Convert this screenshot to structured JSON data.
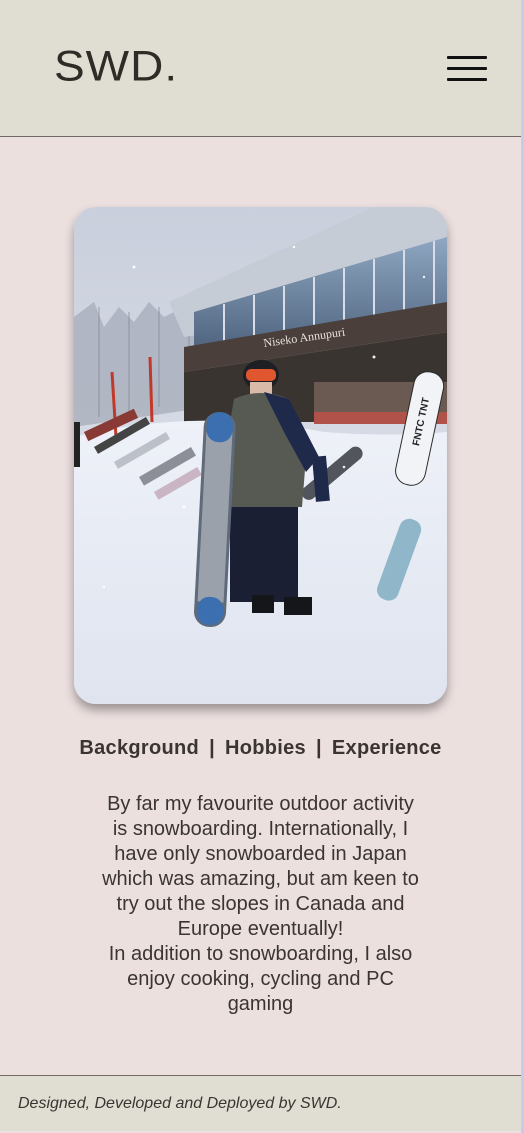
{
  "header": {
    "logo": "SWD.",
    "menu_icon": "hamburger-menu-icon"
  },
  "hero": {
    "image_sign_text": "Niseko Annupuri",
    "board_text": "FNTC TNT"
  },
  "tabs": [
    {
      "label": "Background"
    },
    {
      "label": "Hobbies"
    },
    {
      "label": "Experience"
    }
  ],
  "tab_separator": "|",
  "content": {
    "paragraph_1": "By far my favourite outdoor activity is snowboarding. Internationally, I have only snowboarded in Japan which was amazing, but am keen to try out the slopes in Canada and Europe eventually!",
    "paragraph_2": "In addition to snowboarding, I also enjoy cooking, cycling and PC gaming"
  },
  "footer": {
    "credit": "Designed, Developed and Deployed by SWD."
  },
  "colors": {
    "page_background": "#ece0df",
    "header_background": "#e0ded3",
    "text": "#3a3531"
  }
}
